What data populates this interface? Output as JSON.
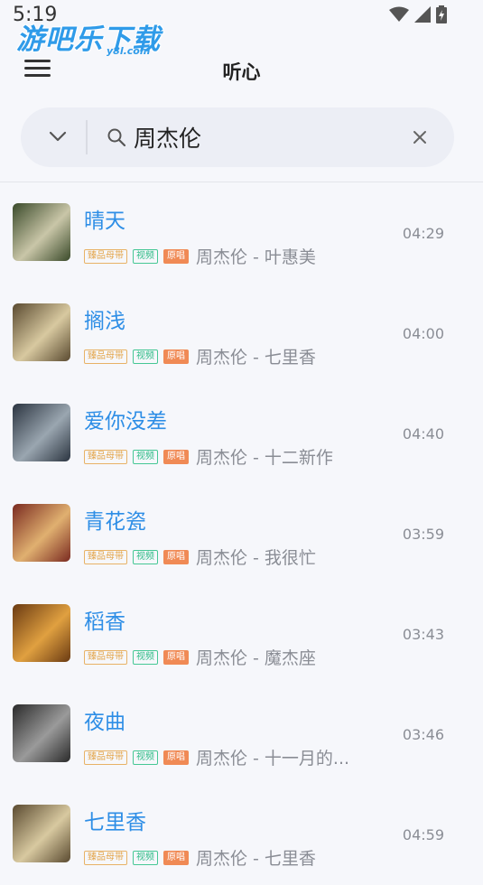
{
  "status_bar": {
    "time": "5:19"
  },
  "watermark": {
    "text": "游吧乐下载",
    "sub": "y8l.com"
  },
  "header": {
    "title": "听心"
  },
  "search": {
    "value": "周杰伦"
  },
  "tags": {
    "quality": "臻品母带",
    "video": "视频",
    "original": "原唱"
  },
  "songs": [
    {
      "title": "晴天",
      "artist": "周杰伦 - 叶惠美",
      "duration": "04:29",
      "cover_colors": [
        "#3a4a2a",
        "#c9c6a8"
      ]
    },
    {
      "title": "搁浅",
      "artist": "周杰伦 - 七里香",
      "duration": "04:00",
      "cover_colors": [
        "#5a4a30",
        "#d8c9a0"
      ]
    },
    {
      "title": "爱你没差",
      "artist": "周杰伦 - 十二新作",
      "duration": "04:40",
      "cover_colors": [
        "#2b3440",
        "#9aa6b0"
      ]
    },
    {
      "title": "青花瓷",
      "artist": "周杰伦 - 我很忙",
      "duration": "03:59",
      "cover_colors": [
        "#7a2a20",
        "#e0b070"
      ]
    },
    {
      "title": "稻香",
      "artist": "周杰伦 - 魔杰座",
      "duration": "03:43",
      "cover_colors": [
        "#6a3a12",
        "#e0a040"
      ]
    },
    {
      "title": "夜曲",
      "artist": "周杰伦 - 十一月的...",
      "duration": "03:46",
      "cover_colors": [
        "#2a2a2a",
        "#9a9a9a"
      ]
    },
    {
      "title": "七里香",
      "artist": "周杰伦 - 七里香",
      "duration": "04:59",
      "cover_colors": [
        "#5a4a30",
        "#d8c9a0"
      ]
    }
  ]
}
